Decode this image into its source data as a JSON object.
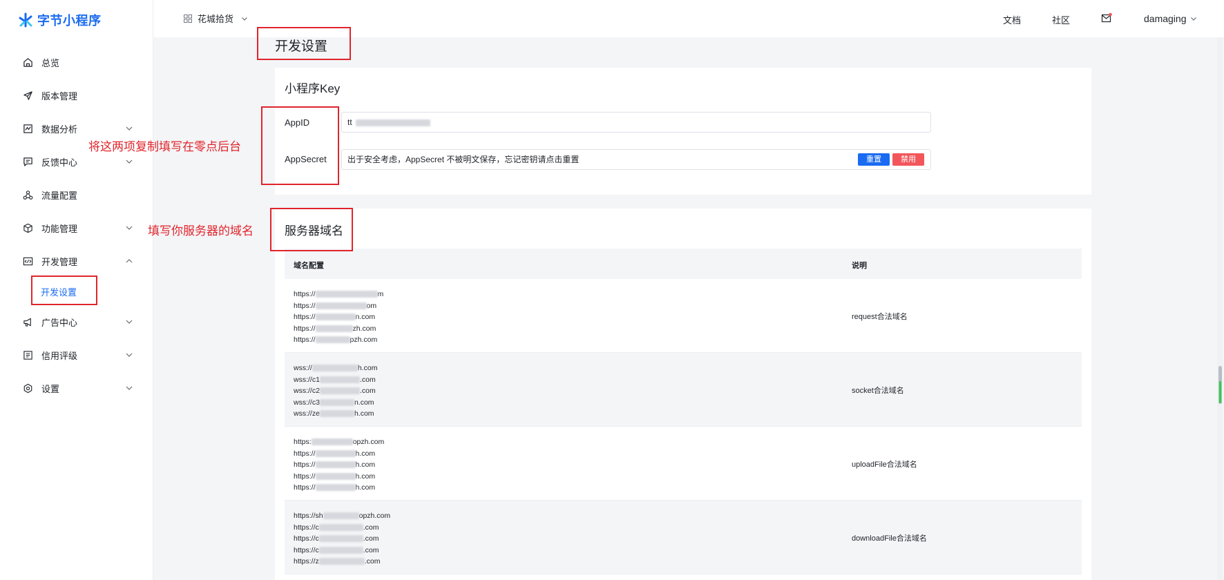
{
  "brand": {
    "name": "字节小程序",
    "color": "#1a6bf2"
  },
  "sidebar": {
    "items": [
      {
        "label": "总览",
        "icon": "home-icon",
        "expandable": false
      },
      {
        "label": "版本管理",
        "icon": "send-icon",
        "expandable": false
      },
      {
        "label": "数据分析",
        "icon": "chart-icon",
        "expandable": true
      },
      {
        "label": "反馈中心",
        "icon": "message-icon",
        "expandable": true
      },
      {
        "label": "流量配置",
        "icon": "share-icon",
        "expandable": false
      },
      {
        "label": "功能管理",
        "icon": "cube-icon",
        "expandable": true
      },
      {
        "label": "开发管理",
        "icon": "code-icon",
        "expandable": true,
        "expanded": true
      },
      {
        "label": "广告中心",
        "icon": "megaphone-icon",
        "expandable": true
      },
      {
        "label": "信用评级",
        "icon": "document-icon",
        "expandable": true
      },
      {
        "label": "设置",
        "icon": "settings-icon",
        "expandable": true
      }
    ],
    "active_sub": "开发设置"
  },
  "topbar": {
    "app_name": "花城拾货",
    "links": [
      "文档",
      "社区"
    ],
    "user": "damaging",
    "has_notification": true
  },
  "page": {
    "title": "开发设置"
  },
  "key_section": {
    "title": "小程序Key",
    "appid_label": "AppID",
    "appid_value": "tt",
    "appsecret_label": "AppSecret",
    "appsecret_hint": "出于安全考虑，AppSecret 不被明文保存，忘记密钥请点击重置",
    "reset_button": "重置",
    "disable_button": "禁用"
  },
  "domain_section": {
    "title": "服务器域名",
    "columns": [
      "域名配置",
      "说明"
    ],
    "rows": [
      {
        "urls": [
          "https://",
          "https://",
          "https://",
          "https://",
          "https://"
        ],
        "suffixes": [
          "m",
          "om",
          "n.com",
          "zh.com",
          "pzh.com"
        ],
        "desc": "request合法域名"
      },
      {
        "urls": [
          "wss://",
          "wss://c1",
          "wss://c2",
          "wss://c3",
          "wss://ze"
        ],
        "suffixes": [
          "h.com",
          ".com",
          ".com",
          "n.com",
          "h.com"
        ],
        "desc": "socket合法域名"
      },
      {
        "urls": [
          "https:",
          "https://",
          "https://",
          "https://",
          "https://"
        ],
        "suffixes": [
          "opzh.com",
          "h.com",
          "h.com",
          "h.com",
          "h.com"
        ],
        "desc": "uploadFile合法域名"
      },
      {
        "urls": [
          "https://sh",
          "https://c",
          "https://c",
          "https://c",
          "https://z"
        ],
        "suffixes": [
          "opzh.com",
          ".com",
          ".com",
          ".com",
          ".com"
        ],
        "desc": "downloadFile合法域名"
      }
    ]
  },
  "annotations": {
    "copy_note": "将这两项复制填写在零点后台",
    "domain_note": "填写你服务器的域名",
    "color": "#e0242b"
  }
}
